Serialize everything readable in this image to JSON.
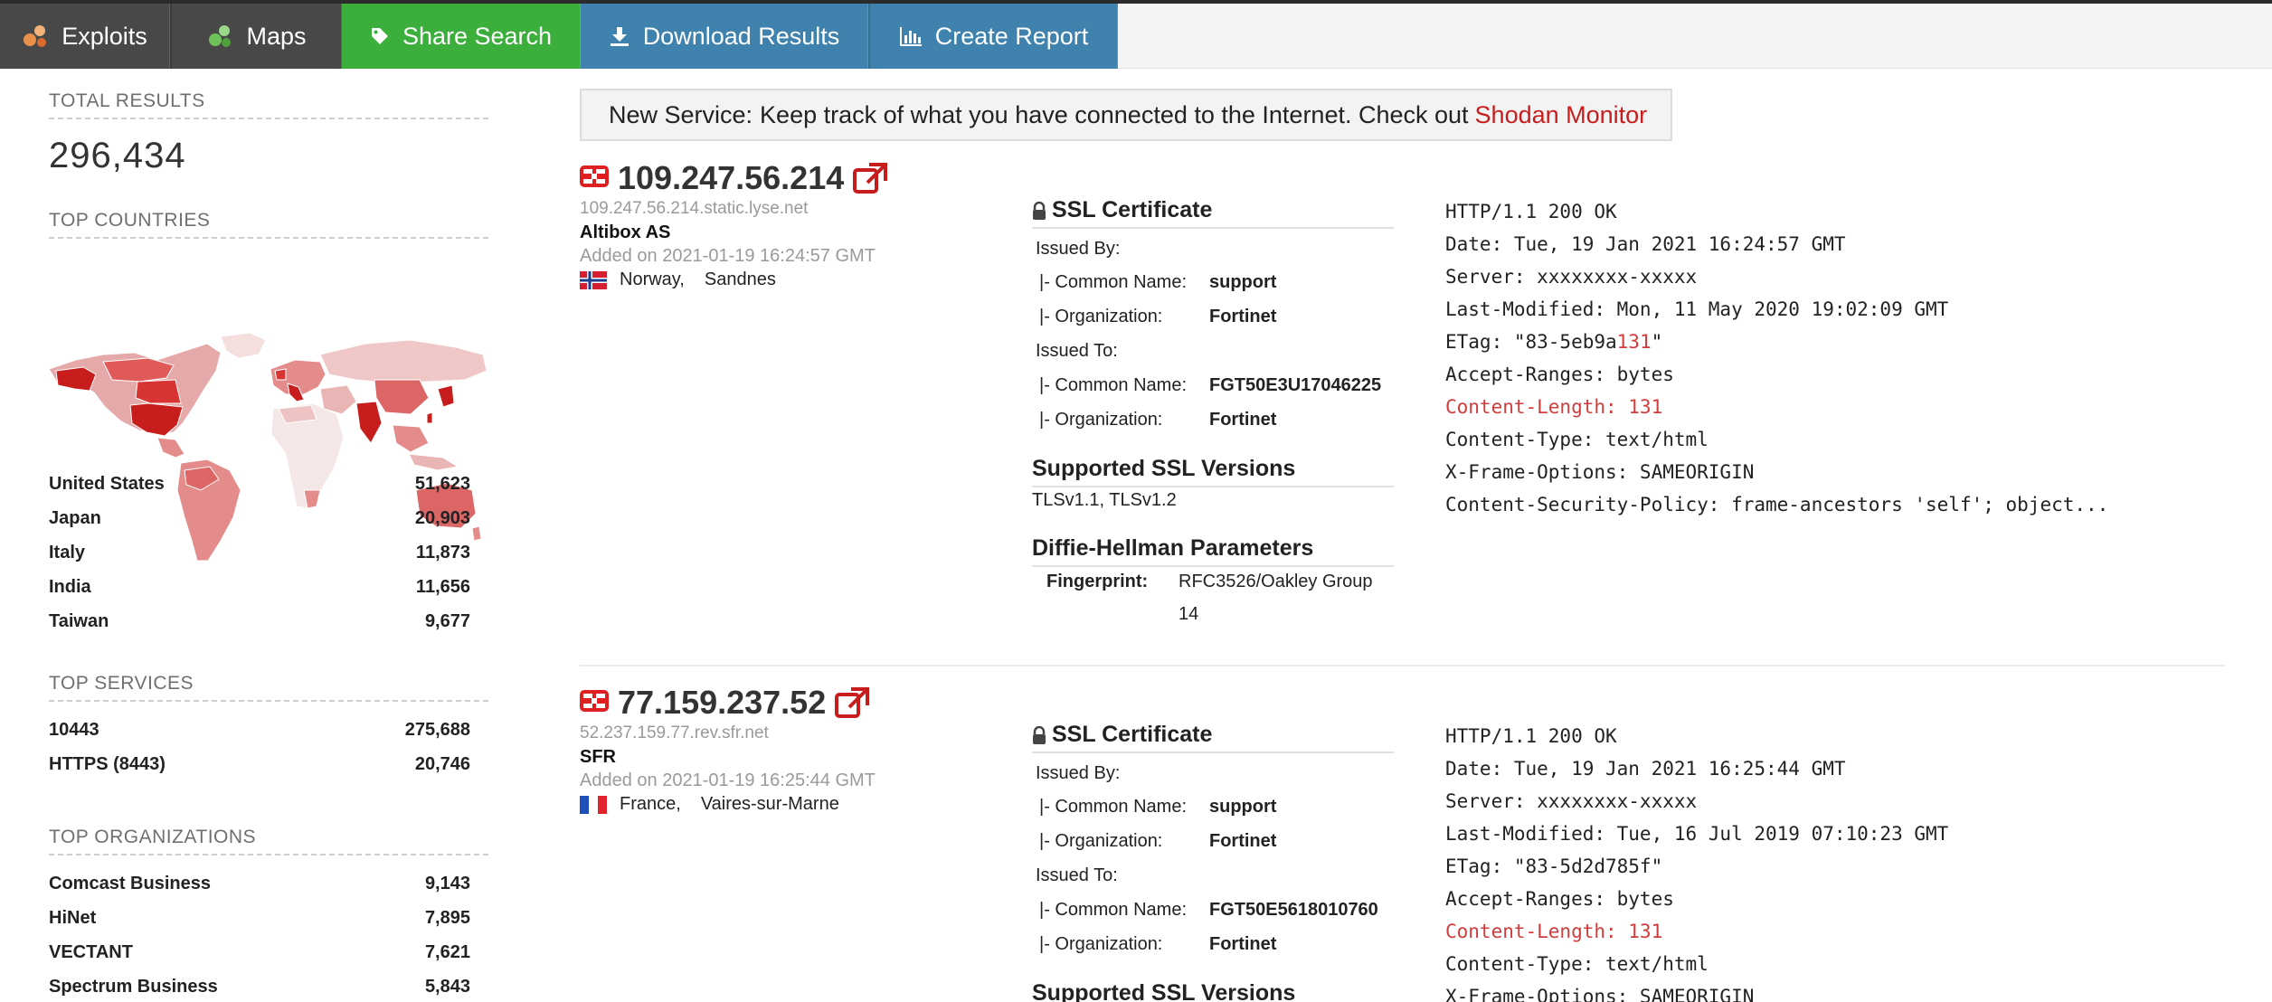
{
  "nav": {
    "exploits": "Exploits",
    "maps": "Maps",
    "share": "Share Search",
    "download": "Download Results",
    "report": "Create Report"
  },
  "sidebar": {
    "total_heading": "TOTAL RESULTS",
    "total_value": "296,434",
    "countries_heading": "TOP COUNTRIES",
    "countries": [
      {
        "name": "United States",
        "count": "51,623"
      },
      {
        "name": "Japan",
        "count": "20,903"
      },
      {
        "name": "Italy",
        "count": "11,873"
      },
      {
        "name": "India",
        "count": "11,656"
      },
      {
        "name": "Taiwan",
        "count": "9,677"
      }
    ],
    "services_heading": "TOP SERVICES",
    "services": [
      {
        "name": "10443",
        "count": "275,688"
      },
      {
        "name": "HTTPS (8443)",
        "count": "20,746"
      }
    ],
    "orgs_heading": "TOP ORGANIZATIONS",
    "orgs": [
      {
        "name": "Comcast Business",
        "count": "9,143"
      },
      {
        "name": "HiNet",
        "count": "7,895"
      },
      {
        "name": "VECTANT",
        "count": "7,621"
      },
      {
        "name": "Spectrum Business",
        "count": "5,843"
      }
    ]
  },
  "banner": {
    "prefix": "New Service:",
    "text": "Keep track of what you have connected to the Internet. Check out",
    "link": "Shodan Monitor"
  },
  "results": [
    {
      "ip": "109.247.56.214",
      "hostname": "109.247.56.214.static.lyse.net",
      "org": "Altibox AS",
      "added": "Added on 2021-01-19 16:24:57 GMT",
      "country": "Norway,",
      "city": "Sandnes",
      "ssl": {
        "cert_heading": "SSL Certificate",
        "issued_by": "Issued By:",
        "cn_label": "|- Common Name:",
        "org_label": "|- Organization:",
        "issuer_cn": "support",
        "issuer_org": "Fortinet",
        "issued_to": "Issued To:",
        "subject_cn": "FGT50E3U17046225",
        "subject_org": "Fortinet",
        "versions_heading": "Supported SSL Versions",
        "versions": "TLSv1.1, TLSv1.2",
        "dh_heading": "Diffie-Hellman Parameters",
        "fp_label": "Fingerprint:",
        "fp_value_1": "RFC3526/Oakley Group",
        "fp_value_2": "14"
      },
      "http": {
        "l1": "HTTP/1.1 200 OK",
        "l2": "Date: Tue, 19 Jan 2021 16:24:57 GMT",
        "l3": "Server: xxxxxxxx-xxxxx",
        "l4": "Last-Modified: Mon, 11 May 2020 19:02:09 GMT",
        "l5a": "ETag: \"83-5eb9a",
        "l5b": "131",
        "l5c": "\"",
        "l6": "Accept-Ranges: bytes",
        "l7": "Content-Length: 131",
        "l8": "Content-Type: text/html",
        "l9": "X-Frame-Options: SAMEORIGIN",
        "l10": "Content-Security-Policy: frame-ancestors 'self'; object..."
      }
    },
    {
      "ip": "77.159.237.52",
      "hostname": "52.237.159.77.rev.sfr.net",
      "org": "SFR",
      "added": "Added on 2021-01-19 16:25:44 GMT",
      "country": "France,",
      "city": "Vaires-sur-Marne",
      "ssl": {
        "cert_heading": "SSL Certificate",
        "issued_by": "Issued By:",
        "cn_label": "|- Common Name:",
        "org_label": "|- Organization:",
        "issuer_cn": "support",
        "issuer_org": "Fortinet",
        "issued_to": "Issued To:",
        "subject_cn": "FGT50E5618010760",
        "subject_org": "Fortinet",
        "versions_heading": "Supported SSL Versions"
      },
      "http": {
        "l1": "HTTP/1.1 200 OK",
        "l2": "Date: Tue, 19 Jan 2021 16:25:44 GMT",
        "l3": "Server: xxxxxxxx-xxxxx",
        "l4": "Last-Modified: Tue, 16 Jul 2019 07:10:23 GMT",
        "l5": "ETag: \"83-5d2d785f\"",
        "l6": "Accept-Ranges: bytes",
        "l7": "Content-Length: 131",
        "l8": "Content-Type: text/html",
        "l9": "X-Frame-Options: SAMEORIGIN"
      }
    }
  ],
  "colors": {
    "brand_red": "#c81d1d",
    "nav_dark": "#484848",
    "share_green": "#3cae3c",
    "action_blue": "#3e82ad"
  }
}
